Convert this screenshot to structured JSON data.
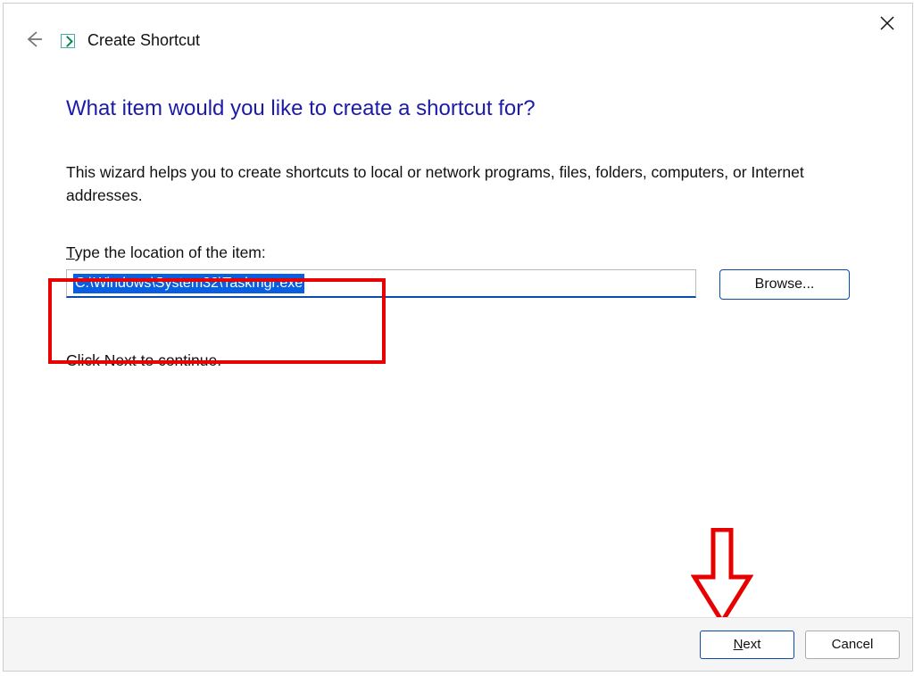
{
  "window": {
    "title": "Create Shortcut"
  },
  "heading": "What item would you like to create a shortcut for?",
  "description": "This wizard helps you to create shortcuts to local or network programs, files, folders, computers, or Internet addresses.",
  "field": {
    "label_prefix_underlined": "T",
    "label_rest": "ype the location of the item:",
    "value": "C:\\Windows\\System32\\Taskmgr.exe"
  },
  "buttons": {
    "browse": "Browse...",
    "next_underlined": "N",
    "next_rest": "ext",
    "cancel": "Cancel"
  },
  "continue_text": "Click Next to continue.",
  "annotations": {
    "highlight_box": true,
    "arrow_points_to": "next-button"
  }
}
